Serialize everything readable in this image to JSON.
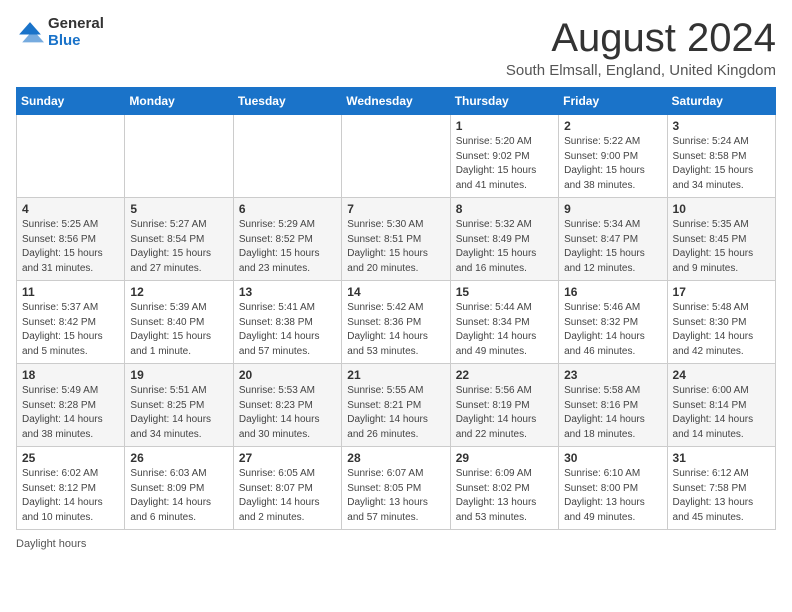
{
  "header": {
    "logo_general": "General",
    "logo_blue": "Blue",
    "month_title": "August 2024",
    "location": "South Elmsall, England, United Kingdom"
  },
  "days_of_week": [
    "Sunday",
    "Monday",
    "Tuesday",
    "Wednesday",
    "Thursday",
    "Friday",
    "Saturday"
  ],
  "weeks": [
    [
      {
        "num": "",
        "info": ""
      },
      {
        "num": "",
        "info": ""
      },
      {
        "num": "",
        "info": ""
      },
      {
        "num": "",
        "info": ""
      },
      {
        "num": "1",
        "info": "Sunrise: 5:20 AM\nSunset: 9:02 PM\nDaylight: 15 hours\nand 41 minutes."
      },
      {
        "num": "2",
        "info": "Sunrise: 5:22 AM\nSunset: 9:00 PM\nDaylight: 15 hours\nand 38 minutes."
      },
      {
        "num": "3",
        "info": "Sunrise: 5:24 AM\nSunset: 8:58 PM\nDaylight: 15 hours\nand 34 minutes."
      }
    ],
    [
      {
        "num": "4",
        "info": "Sunrise: 5:25 AM\nSunset: 8:56 PM\nDaylight: 15 hours\nand 31 minutes."
      },
      {
        "num": "5",
        "info": "Sunrise: 5:27 AM\nSunset: 8:54 PM\nDaylight: 15 hours\nand 27 minutes."
      },
      {
        "num": "6",
        "info": "Sunrise: 5:29 AM\nSunset: 8:52 PM\nDaylight: 15 hours\nand 23 minutes."
      },
      {
        "num": "7",
        "info": "Sunrise: 5:30 AM\nSunset: 8:51 PM\nDaylight: 15 hours\nand 20 minutes."
      },
      {
        "num": "8",
        "info": "Sunrise: 5:32 AM\nSunset: 8:49 PM\nDaylight: 15 hours\nand 16 minutes."
      },
      {
        "num": "9",
        "info": "Sunrise: 5:34 AM\nSunset: 8:47 PM\nDaylight: 15 hours\nand 12 minutes."
      },
      {
        "num": "10",
        "info": "Sunrise: 5:35 AM\nSunset: 8:45 PM\nDaylight: 15 hours\nand 9 minutes."
      }
    ],
    [
      {
        "num": "11",
        "info": "Sunrise: 5:37 AM\nSunset: 8:42 PM\nDaylight: 15 hours\nand 5 minutes."
      },
      {
        "num": "12",
        "info": "Sunrise: 5:39 AM\nSunset: 8:40 PM\nDaylight: 15 hours\nand 1 minute."
      },
      {
        "num": "13",
        "info": "Sunrise: 5:41 AM\nSunset: 8:38 PM\nDaylight: 14 hours\nand 57 minutes."
      },
      {
        "num": "14",
        "info": "Sunrise: 5:42 AM\nSunset: 8:36 PM\nDaylight: 14 hours\nand 53 minutes."
      },
      {
        "num": "15",
        "info": "Sunrise: 5:44 AM\nSunset: 8:34 PM\nDaylight: 14 hours\nand 49 minutes."
      },
      {
        "num": "16",
        "info": "Sunrise: 5:46 AM\nSunset: 8:32 PM\nDaylight: 14 hours\nand 46 minutes."
      },
      {
        "num": "17",
        "info": "Sunrise: 5:48 AM\nSunset: 8:30 PM\nDaylight: 14 hours\nand 42 minutes."
      }
    ],
    [
      {
        "num": "18",
        "info": "Sunrise: 5:49 AM\nSunset: 8:28 PM\nDaylight: 14 hours\nand 38 minutes."
      },
      {
        "num": "19",
        "info": "Sunrise: 5:51 AM\nSunset: 8:25 PM\nDaylight: 14 hours\nand 34 minutes."
      },
      {
        "num": "20",
        "info": "Sunrise: 5:53 AM\nSunset: 8:23 PM\nDaylight: 14 hours\nand 30 minutes."
      },
      {
        "num": "21",
        "info": "Sunrise: 5:55 AM\nSunset: 8:21 PM\nDaylight: 14 hours\nand 26 minutes."
      },
      {
        "num": "22",
        "info": "Sunrise: 5:56 AM\nSunset: 8:19 PM\nDaylight: 14 hours\nand 22 minutes."
      },
      {
        "num": "23",
        "info": "Sunrise: 5:58 AM\nSunset: 8:16 PM\nDaylight: 14 hours\nand 18 minutes."
      },
      {
        "num": "24",
        "info": "Sunrise: 6:00 AM\nSunset: 8:14 PM\nDaylight: 14 hours\nand 14 minutes."
      }
    ],
    [
      {
        "num": "25",
        "info": "Sunrise: 6:02 AM\nSunset: 8:12 PM\nDaylight: 14 hours\nand 10 minutes."
      },
      {
        "num": "26",
        "info": "Sunrise: 6:03 AM\nSunset: 8:09 PM\nDaylight: 14 hours\nand 6 minutes."
      },
      {
        "num": "27",
        "info": "Sunrise: 6:05 AM\nSunset: 8:07 PM\nDaylight: 14 hours\nand 2 minutes."
      },
      {
        "num": "28",
        "info": "Sunrise: 6:07 AM\nSunset: 8:05 PM\nDaylight: 13 hours\nand 57 minutes."
      },
      {
        "num": "29",
        "info": "Sunrise: 6:09 AM\nSunset: 8:02 PM\nDaylight: 13 hours\nand 53 minutes."
      },
      {
        "num": "30",
        "info": "Sunrise: 6:10 AM\nSunset: 8:00 PM\nDaylight: 13 hours\nand 49 minutes."
      },
      {
        "num": "31",
        "info": "Sunrise: 6:12 AM\nSunset: 7:58 PM\nDaylight: 13 hours\nand 45 minutes."
      }
    ]
  ],
  "footer": {
    "daylight_label": "Daylight hours"
  }
}
